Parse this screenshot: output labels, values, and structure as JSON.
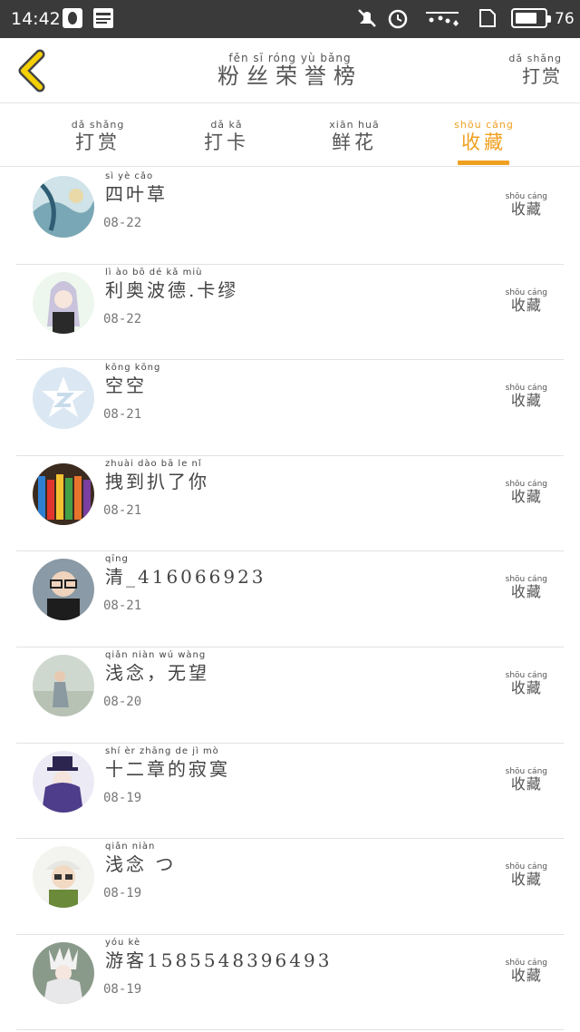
{
  "status_bar": {
    "time": "14:42",
    "battery_level": 76,
    "battery_text": "76",
    "icons": [
      "qq-icon",
      "news-icon",
      "mute-icon",
      "alarm-icon",
      "signal-icon",
      "sim-icon",
      "battery-icon"
    ]
  },
  "header": {
    "title_pinyin": "fěn sī róng yù bǎng",
    "title": "粉丝荣誉榜",
    "reward_pinyin": "dǎ shǎng",
    "reward": "打赏"
  },
  "tabs": [
    {
      "pinyin": "dǎ shǎng",
      "label": "打赏",
      "active": false
    },
    {
      "pinyin": "dǎ kǎ",
      "label": "打卡",
      "active": false
    },
    {
      "pinyin": "xiān huā",
      "label": "鲜花",
      "active": false
    },
    {
      "pinyin": "shōu cáng",
      "label": "收藏",
      "active": true
    }
  ],
  "colors": {
    "accent": "#f0a020",
    "divider": "#e2e2e2",
    "status_bar": "#3a3a3a"
  },
  "list": [
    {
      "pinyin": "sì yè cǎo",
      "name": "四叶草",
      "date": "08-22",
      "tag_pinyin": "shōu cáng",
      "tag": "收藏",
      "avatar": "avatar-art"
    },
    {
      "pinyin": "lì ào bō dé kǎ miù",
      "name": "利奥波德.卡缪",
      "date": "08-22",
      "tag_pinyin": "shōu cáng",
      "tag": "收藏",
      "avatar": "avatar-anime-girl"
    },
    {
      "pinyin": "kōng kōng",
      "name": "空空",
      "date": "08-21",
      "tag_pinyin": "shōu cáng",
      "tag": "收藏",
      "avatar": "avatar-default"
    },
    {
      "pinyin": "zhuài dào bā le nǐ",
      "name": "拽到扒了你",
      "date": "08-21",
      "tag_pinyin": "shōu cáng",
      "tag": "收藏",
      "avatar": "avatar-pencils"
    },
    {
      "pinyin": "qīng",
      "name": "清_416066923",
      "date": "08-21",
      "tag_pinyin": "shōu cáng",
      "tag": "收藏",
      "avatar": "avatar-boy"
    },
    {
      "pinyin": "qiǎn niàn wú wàng",
      "name": "浅念，无望",
      "date": "08-20",
      "tag_pinyin": "shōu cáng",
      "tag": "收藏",
      "avatar": "avatar-girl"
    },
    {
      "pinyin": "shí èr zhāng de jì mò",
      "name": "十二章的寂寞",
      "date": "08-19",
      "tag_pinyin": "shōu cáng",
      "tag": "收藏",
      "avatar": "avatar-anime-hat"
    },
    {
      "pinyin": "qiǎn niàn",
      "name": "浅念 つ",
      "date": "08-19",
      "tag_pinyin": "shōu cáng",
      "tag": "收藏",
      "avatar": "avatar-cap-boy"
    },
    {
      "pinyin": "yóu kè",
      "name": "游客1585548396493",
      "date": "08-19",
      "tag_pinyin": "shōu cáng",
      "tag": "收藏",
      "avatar": "avatar-anime-white"
    }
  ]
}
